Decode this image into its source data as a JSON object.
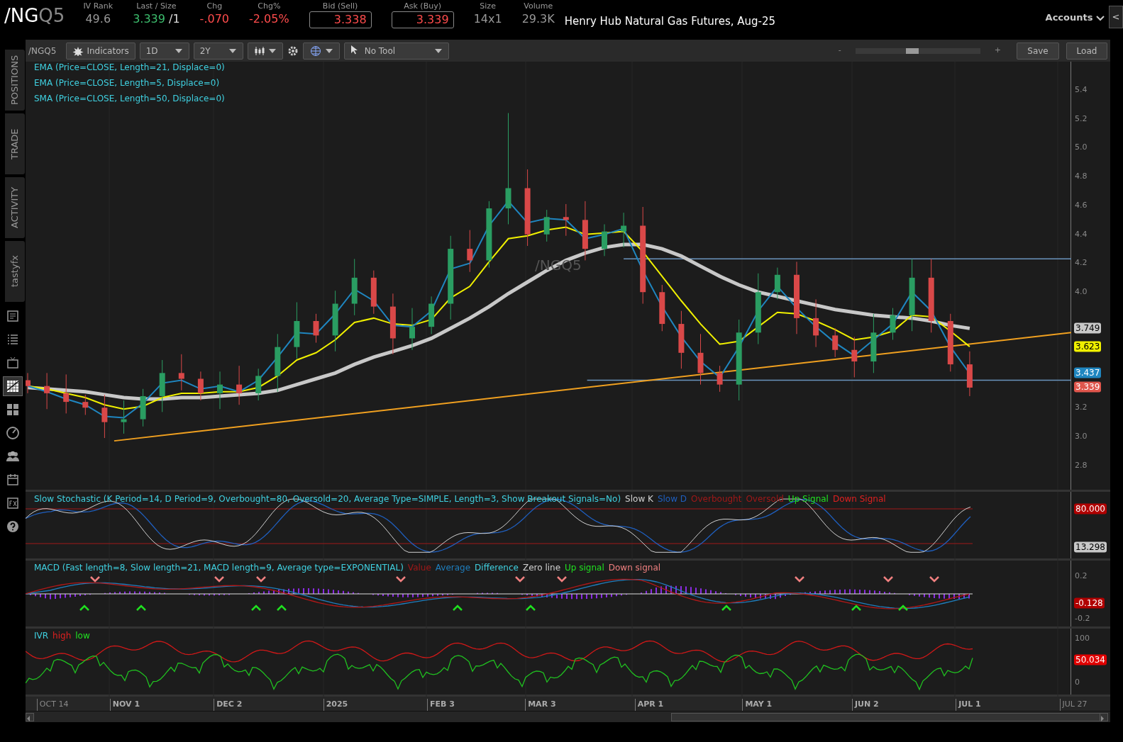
{
  "quote_bar": {
    "symbol_root": "/NG",
    "symbol_month": "Q5",
    "fields": [
      {
        "label": "IV Rank",
        "value": "49.6",
        "color": "#999999",
        "kind": "plain"
      },
      {
        "label": "Last / Size",
        "value": "3.339",
        "suffix": "/1",
        "color": "#3dbf6e",
        "kind": "plain"
      },
      {
        "label": "Chg",
        "value": "-.070",
        "color": "#ff4c4c",
        "kind": "plain"
      },
      {
        "label": "Chg%",
        "value": "-2.05%",
        "color": "#ff4c4c",
        "kind": "plain"
      },
      {
        "label": "Bid (Sell)",
        "value": "3.338",
        "color": "#ff4c4c",
        "kind": "boxed"
      },
      {
        "label": "Ask (Buy)",
        "value": "3.339",
        "color": "#ff4c4c",
        "kind": "boxed"
      },
      {
        "label": "Size",
        "value": "14x1",
        "color": "#999999",
        "kind": "plain"
      },
      {
        "label": "Volume",
        "value": "29.3K",
        "color": "#999999",
        "kind": "plain"
      }
    ],
    "description": "Henry Hub Natural Gas Futures, Aug-25",
    "accounts_menu": "Accounts",
    "collapse_button": "<"
  },
  "sidebar": {
    "tabs": [
      {
        "label": "POSITIONS"
      },
      {
        "label": "TRADE"
      },
      {
        "label": "ACTIVITY"
      },
      {
        "label": "tastyfx"
      }
    ],
    "tools": [
      {
        "kind": "news",
        "selected": false
      },
      {
        "kind": "list",
        "selected": false
      },
      {
        "kind": "tv",
        "selected": false
      },
      {
        "kind": "chart",
        "selected": true
      },
      {
        "kind": "grid",
        "selected": false
      },
      {
        "kind": "gauge",
        "selected": false
      },
      {
        "kind": "people",
        "selected": false
      },
      {
        "kind": "calendar",
        "selected": false
      },
      {
        "kind": "fx",
        "selected": false
      },
      {
        "kind": "help",
        "selected": false
      }
    ]
  },
  "toolbar": {
    "symbol": "/NGQ5",
    "indicators_button": "Indicators",
    "aggregation": "1D",
    "timeframe": "2Y",
    "drawing_tool": "No Tool",
    "zoom_out": "-",
    "zoom_in": "+",
    "zoom": {
      "level": 0.45
    },
    "save_button": "Save",
    "load_button": "Load"
  },
  "price_chart": {
    "studies": [
      "EMA (Price=CLOSE, Length=21, Displace=0)",
      "EMA (Price=CLOSE, Length=5, Displace=0)",
      "SMA (Price=CLOSE, Length=50, Displace=0)"
    ],
    "watermark": "/NGQ5",
    "axis_labels": [
      "5.4",
      "5.2",
      "5.0",
      "4.8",
      "4.6",
      "4.4",
      "4.2",
      "4.0",
      "3.2",
      "3.0",
      "2.8"
    ],
    "badges": [
      {
        "text": "3.749",
        "color": "#c8c8c8"
      },
      {
        "text": "3.623",
        "color": "#f0f000"
      },
      {
        "text": "3.437",
        "color": "#1f86c0"
      },
      {
        "text": "3.339",
        "color": "#e0564c"
      }
    ],
    "date_labels": [
      {
        "label": "OCT 14",
        "muted": true
      },
      {
        "label": "NOV 1",
        "muted": false
      },
      {
        "label": "DEC 2",
        "muted": false
      },
      {
        "label": "2025",
        "muted": false
      },
      {
        "label": "FEB 3",
        "muted": false
      },
      {
        "label": "MAR 3",
        "muted": false
      },
      {
        "label": "APR 1",
        "muted": false
      },
      {
        "label": "MAY 1",
        "muted": false
      },
      {
        "label": "JUN 2",
        "muted": false
      },
      {
        "label": "JUL 1",
        "muted": false
      },
      {
        "label": "JUL 27",
        "muted": true
      }
    ]
  },
  "stochastic": {
    "title": "Slow Stochastic (K Period=14, D Period=9, Overbought=80, Oversold=20, Average Type=SIMPLE, Length=3, Show Breakout Signals=No)",
    "legend": [
      {
        "text": "Slow K",
        "color": "#d0d0d0"
      },
      {
        "text": "Slow D",
        "color": "#1f5fbf"
      },
      {
        "text": "Overbought",
        "color": "#a01818"
      },
      {
        "text": "Oversold",
        "color": "#a01818"
      },
      {
        "text": "Up Signal",
        "color": "#20e020"
      },
      {
        "text": "Down Signal",
        "color": "#e02020"
      }
    ],
    "badges": [
      {
        "text": "80.000",
        "color": "#b00000"
      },
      {
        "text": "13.298",
        "color": "#c8c8c8"
      }
    ]
  },
  "macd": {
    "title": "MACD (Fast length=8, Slow length=21, MACD length=9, Average type=EXPONENTIAL)",
    "legend": [
      {
        "text": "Value",
        "color": "#a01818"
      },
      {
        "text": "Average",
        "color": "#1f7fbf"
      },
      {
        "text": "Difference",
        "color": "#40d0e0"
      },
      {
        "text": "Zero line",
        "color": "#d0d0d0"
      },
      {
        "text": "Up signal",
        "color": "#20e020"
      },
      {
        "text": "Down signal",
        "color": "#f08080"
      }
    ],
    "ticks": [
      "0.2",
      "-0.2"
    ],
    "badges": [
      {
        "text": "-0.128",
        "color": "#b00000"
      }
    ]
  },
  "ivr": {
    "title": "IVR",
    "legend": [
      {
        "text": "high",
        "color": "#e02020"
      },
      {
        "text": "low",
        "color": "#20e020"
      }
    ],
    "ticks": [
      "100",
      "0"
    ],
    "badges": [
      {
        "text": "50.034",
        "color": "#e00000"
      }
    ]
  }
}
